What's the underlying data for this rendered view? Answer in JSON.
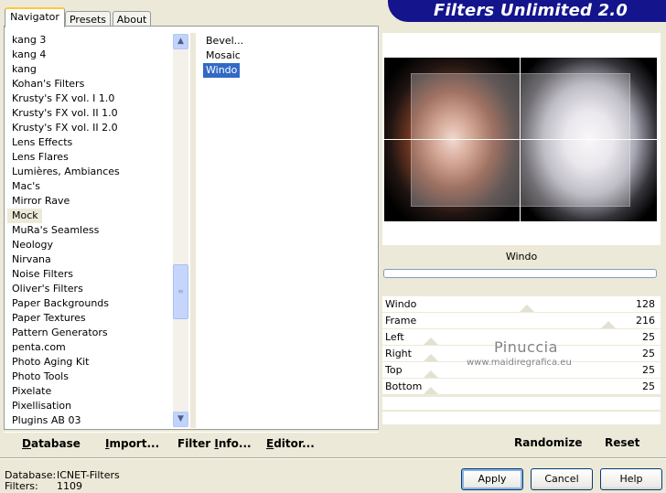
{
  "app": {
    "title": "Filters Unlimited 2.0"
  },
  "tabs": [
    {
      "label": "Navigator",
      "active": true
    },
    {
      "label": "Presets",
      "active": false
    },
    {
      "label": "About",
      "active": false
    }
  ],
  "filter_list": {
    "items": [
      "kang 3",
      "kang 4",
      "kang",
      "Kohan's Filters",
      "Krusty's FX vol. I 1.0",
      "Krusty's FX vol. II 1.0",
      "Krusty's FX vol. II 2.0",
      "Lens Effects",
      "Lens Flares",
      "Lumières, Ambiances",
      "Mac's",
      "Mirror Rave",
      "Mock",
      "MuRa's Seamless",
      "Neology",
      "Nirvana",
      "Noise Filters",
      "Oliver's Filters",
      "Paper Backgrounds",
      "Paper Textures",
      "Pattern Generators",
      "penta.com",
      "Photo Aging Kit",
      "Photo Tools",
      "Pixelate",
      "Pixellisation",
      "Plugins AB 03"
    ],
    "selected": "Mock"
  },
  "sub_list": {
    "items": [
      "Bevel...",
      "Mosaic",
      "Windo"
    ],
    "selected": "Windo"
  },
  "preview": {
    "filter_name": "Windo"
  },
  "params": [
    {
      "name": "Windo",
      "value": "128"
    },
    {
      "name": "Frame",
      "value": "216"
    },
    {
      "name": "Left",
      "value": "25"
    },
    {
      "name": "Right",
      "value": "25"
    },
    {
      "name": "Top",
      "value": "25"
    },
    {
      "name": "Bottom",
      "value": "25"
    }
  ],
  "watermark": {
    "line1": "Pinuccia",
    "line2": "www.maidiregrafica.eu"
  },
  "bottom_left": {
    "database": {
      "u": "D",
      "rest": "atabase"
    },
    "import": {
      "u": "I",
      "rest": "mport..."
    },
    "filter_info": {
      "pre": "Filter ",
      "u": "I",
      "rest": "nfo..."
    },
    "editor": {
      "u": "E",
      "rest": "ditor..."
    }
  },
  "bottom_right": {
    "randomize": "Randomize",
    "reset": "Reset"
  },
  "status": {
    "database_label": "Database:",
    "database_value": "ICNET-Filters",
    "filters_label": "Filters:",
    "filters_value": "1109"
  },
  "dialog_buttons": {
    "apply": "Apply",
    "cancel": "Cancel",
    "help": "Help"
  },
  "colors": {
    "banner": "#14148c",
    "selection": "#316AC5",
    "window_bg": "#ECE9D8"
  }
}
